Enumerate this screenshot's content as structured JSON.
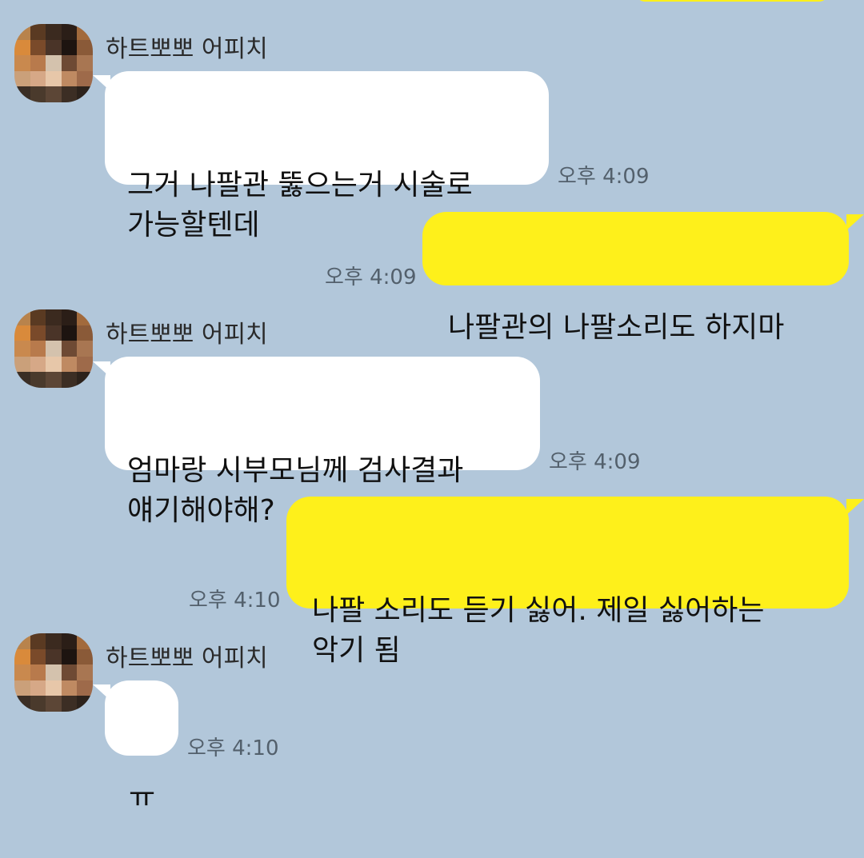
{
  "chat": {
    "messages": [
      {
        "side": "in",
        "sender": "하트뽀뽀 어피치",
        "text": "그거 나팔관 뚫으는거 시술로\n가능할텐데",
        "time": "오후 4:09"
      },
      {
        "side": "out",
        "text": "나팔관의 나팔소리도 하지마",
        "time": "오후 4:09"
      },
      {
        "side": "in",
        "sender": "하트뽀뽀 어피치",
        "text": "엄마랑 시부모님께 검사결과\n얘기해야해?",
        "time": "오후 4:09"
      },
      {
        "side": "out",
        "text": "나팔 소리도 듣기 싫어. 제일 싫어하는\n악기 됨",
        "time": "오후 4:10"
      },
      {
        "side": "in",
        "sender": "하트뽀뽀 어피치",
        "text": "ㅠ",
        "time": "오후 4:10"
      }
    ]
  },
  "avatar": {
    "icon": "pixelated-profile-photo",
    "palette": [
      "#b8834c",
      "#5a3a22",
      "#3b2a1f",
      "#2b1e17",
      "#a26a3c",
      "#d98a3b",
      "#7a4a2a",
      "#4a3428",
      "#1d1410",
      "#8a5a38",
      "#c9894e",
      "#b87a4c",
      "#d4c2ad",
      "#6e4a34",
      "#a87652",
      "#caa07a",
      "#d6a887",
      "#e7c7a9",
      "#bf8a62",
      "#9e6a4a",
      "#3a2e25",
      "#4a3a2c",
      "#5c4636",
      "#3c2e24",
      "#2c221b"
    ]
  },
  "colors": {
    "background": "#b2c7da",
    "incoming": "#ffffff",
    "outgoing": "#fef01b"
  }
}
